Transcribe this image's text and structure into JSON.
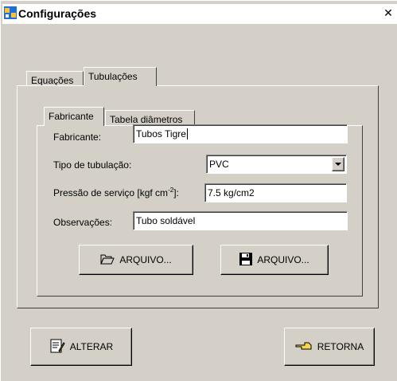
{
  "window": {
    "title": "Configurações"
  },
  "outer_tabs": [
    {
      "label": "Equações"
    },
    {
      "label": "Tubulações"
    }
  ],
  "inner_tabs": [
    {
      "label": "Fabricante"
    },
    {
      "label": "Tabela diâmetros"
    }
  ],
  "form": {
    "fabricante": {
      "label": "Fabricante:",
      "value": "Tubos Tigre"
    },
    "tipo": {
      "label": "Tipo de tubulação:",
      "value": "PVC"
    },
    "pressao": {
      "label_main": "Pressão de serviço [kgf cm",
      "label_sup": "-2",
      "label_end": "]:",
      "value": "7.5 kg/cm2"
    },
    "observacoes": {
      "label": "Observações:",
      "value": "Tubo soldável"
    }
  },
  "buttons": {
    "open_file": {
      "label": "ARQUIVO...",
      "icon": "folder-open-icon"
    },
    "save_file": {
      "label": "ARQUIVO...",
      "icon": "floppy-disk-icon"
    },
    "alterar": {
      "label": "ALTERAR",
      "icon": "edit-document-icon"
    },
    "retorna": {
      "label": "RETORNA",
      "icon": "pointing-hand-icon"
    }
  },
  "colors": {
    "face": "#d4d0c8",
    "titlebar": "#ffffff",
    "field_bg": "#ffffff"
  }
}
